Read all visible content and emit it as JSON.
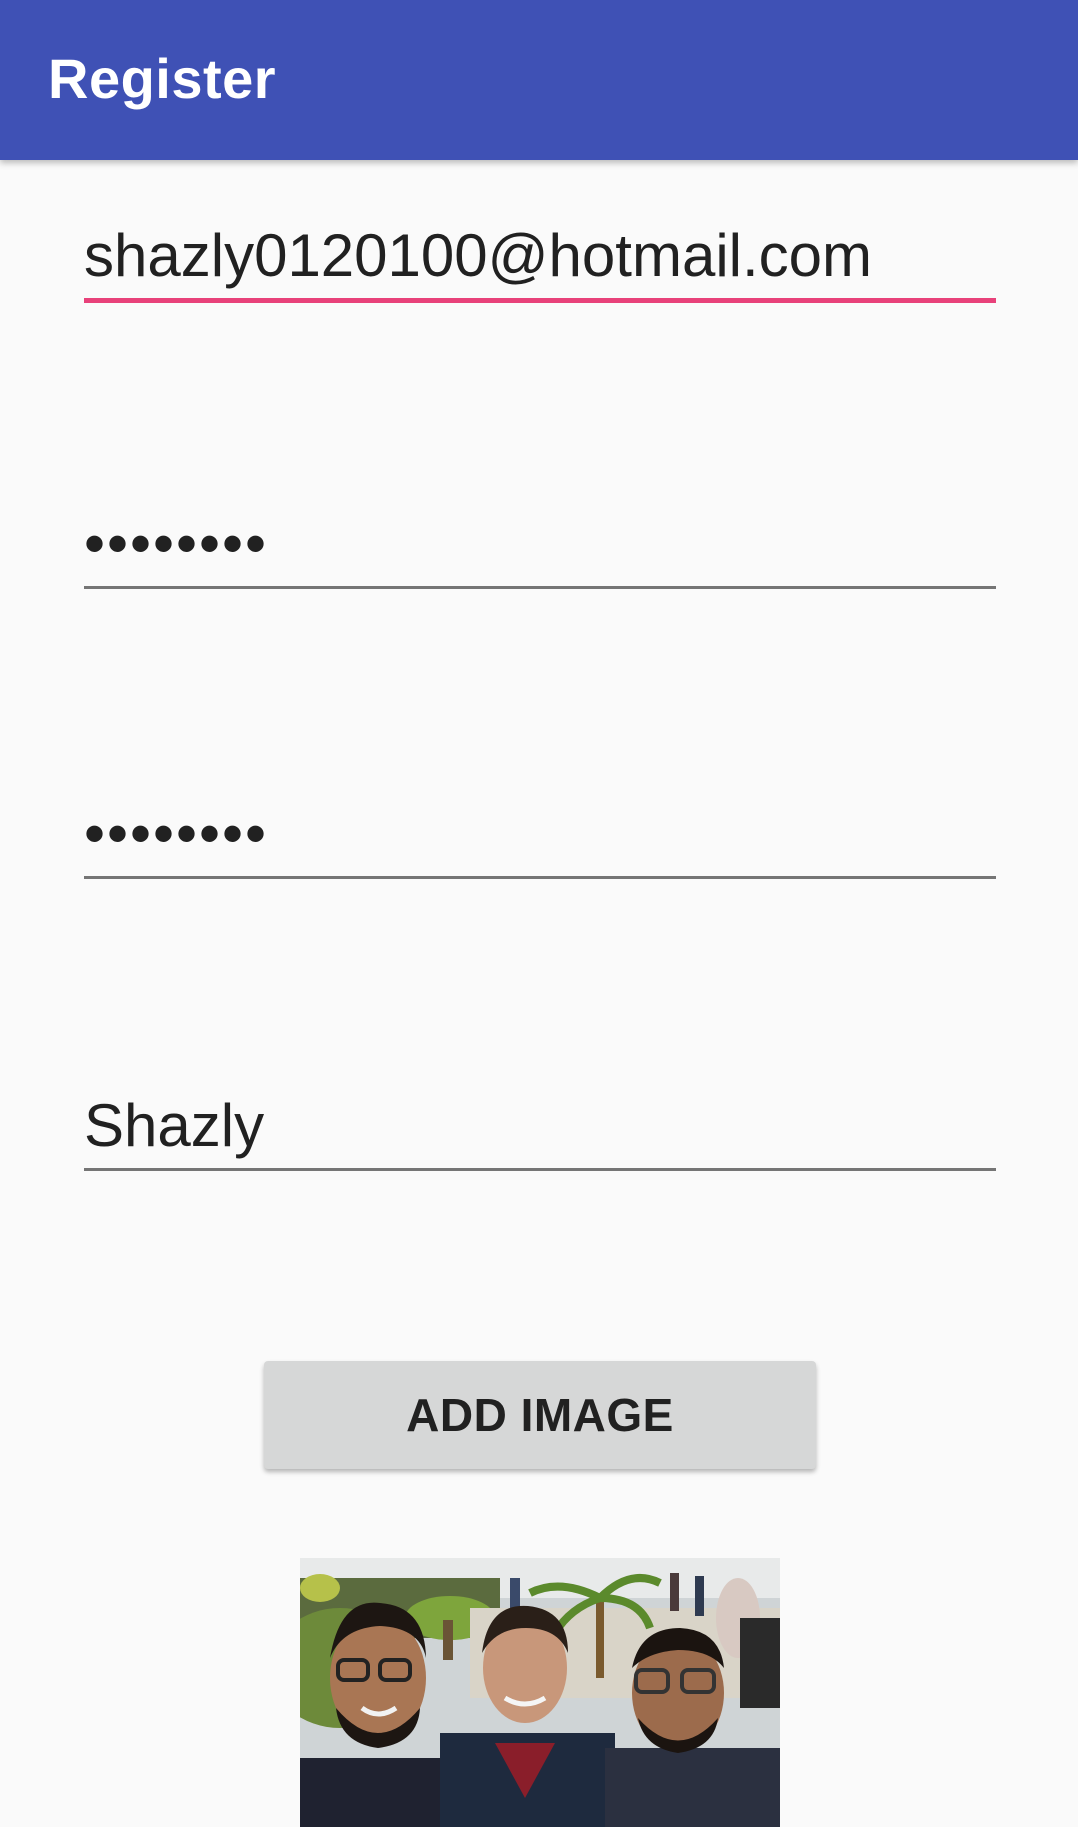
{
  "toolbar": {
    "title": "Register",
    "color": "#3f51b5"
  },
  "form": {
    "email": {
      "value": "shazly0120100@hotmail.com"
    },
    "password": {
      "value": "••••••••"
    },
    "confirm_password": {
      "value": "••••••••"
    },
    "name": {
      "value": "Shazly"
    }
  },
  "add_image_button": {
    "label": "ADD IMAGE"
  },
  "accent_color": "#e8417a",
  "preview_image": {
    "icon": "selfie-photo"
  }
}
